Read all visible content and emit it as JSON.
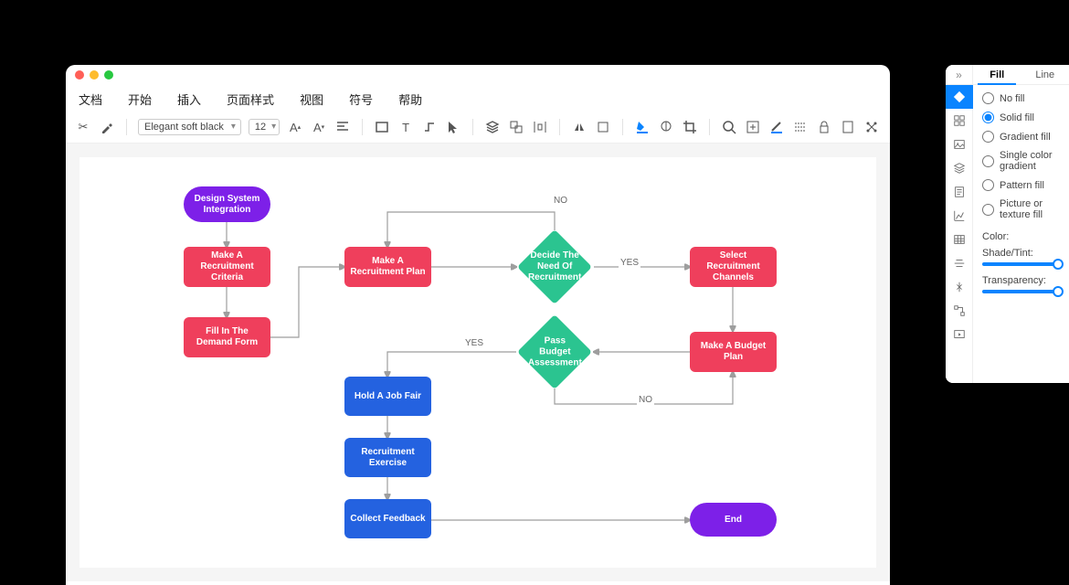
{
  "menu": {
    "items": [
      "文档",
      "开始",
      "插入",
      "页面样式",
      "视图",
      "符号",
      "帮助"
    ]
  },
  "toolbar": {
    "font": "Elegant soft black",
    "size": "12"
  },
  "flow": {
    "nodes": {
      "start": "Design System Integration",
      "criteria": "Make A Recruitment Criteria",
      "demand": "Fill In The Demand Form",
      "plan": "Make A Recruitment Plan",
      "decide": "Decide The Need Of Recruitment",
      "channels": "Select Recruitment Channels",
      "budget_plan": "Make A Budget Plan",
      "pass_budget": "Pass Budget Assessment",
      "job_fair": "Hold A Job Fair",
      "exercise": "Recruitment Exercise",
      "feedback": "Collect Feedback",
      "end": "End"
    },
    "labels": {
      "no1": "NO",
      "yes1": "YES",
      "yes2": "YES",
      "no2": "NO"
    }
  },
  "panel": {
    "tabs": {
      "fill": "Fill",
      "line": "Line"
    },
    "opts": {
      "nofill": "No fill",
      "solid": "Solid fill",
      "gradient": "Gradient fill",
      "single": "Single color gradient",
      "pattern": "Pattern fill",
      "picture": "Picture or texture fill"
    },
    "labels": {
      "color": "Color:",
      "shade": "Shade/Tint:",
      "transparency": "Transparency:"
    }
  }
}
